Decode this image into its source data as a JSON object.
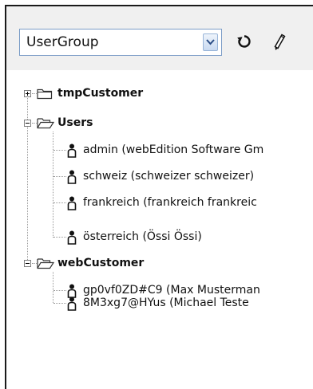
{
  "toolbar": {
    "group_select": {
      "selected": "UserGroup"
    },
    "refresh_icon": "refresh-icon",
    "edit_icon": "pencil-icon"
  },
  "tree": {
    "groups": [
      {
        "label": "tmpCustomer",
        "expanded": false,
        "items": []
      },
      {
        "label": "Users",
        "expanded": true,
        "items": [
          {
            "label": "admin (webEdition Software Gm"
          },
          {
            "label": "schweiz (schweizer schweizer)"
          },
          {
            "label": "frankreich (frankreich frankreic"
          },
          {
            "label": "österreich (Össi Össi)"
          }
        ]
      },
      {
        "label": "webCustomer",
        "expanded": true,
        "items": [
          {
            "label": "gp0vf0ZD#C9 (Max Musterman"
          },
          {
            "label": "8M3xg7@HYus (Michael Teste"
          }
        ]
      }
    ]
  },
  "colors": {
    "select_border": "#7a9cc7",
    "tree_line": "#9a9a9a",
    "panel_bg": "#f0f0f0"
  }
}
